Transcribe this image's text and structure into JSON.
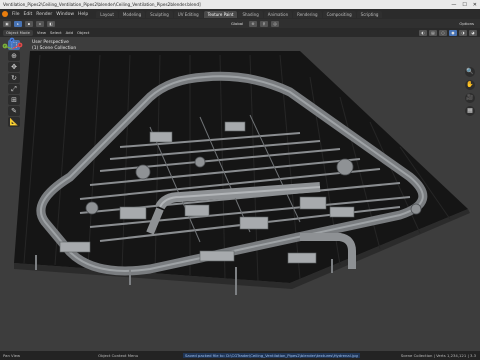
{
  "titlebar": {
    "path": "Ventilation_Pipes2\\Ceiling_Ventilation_Pipes2\\blender\\Ceiling_Ventilation_Pipes2blender.blend]",
    "minimize": "—",
    "maximize": "☐",
    "close": "✕"
  },
  "menubar": {
    "menus": [
      "File",
      "Edit",
      "Render",
      "Window",
      "Help"
    ],
    "tabs": [
      "Layout",
      "Modeling",
      "Sculpting",
      "UV Editing",
      "Texture Paint",
      "Shading",
      "Animation",
      "Rendering",
      "Compositing",
      "Scripting"
    ],
    "active_tab": "Texture Paint",
    "scene": "Scene",
    "view_layer_label": "ViewLayer"
  },
  "header": {
    "orientation": "Global",
    "options": "Options"
  },
  "toolheader": {
    "mode": "Object Mode",
    "menus": [
      "View",
      "Select",
      "Add",
      "Object"
    ]
  },
  "viewport": {
    "view_name": "User Perspective",
    "collection": "(1) Scene Collection"
  },
  "tools": [
    {
      "name": "select-box-tool",
      "glyph": "⬚"
    },
    {
      "name": "cursor-tool",
      "glyph": "⊕"
    },
    {
      "name": "move-tool",
      "glyph": "✥"
    },
    {
      "name": "rotate-tool",
      "glyph": "↻"
    },
    {
      "name": "scale-tool",
      "glyph": "⤢"
    },
    {
      "name": "transform-tool",
      "glyph": "⊞"
    },
    {
      "name": "annotate-tool",
      "glyph": "✎"
    },
    {
      "name": "measure-tool",
      "glyph": "📐"
    }
  ],
  "gizmo": {
    "x": "X",
    "y": "Y",
    "z": "Z"
  },
  "navbuttons": [
    "🔍",
    "✋",
    "🎥",
    "▦"
  ],
  "statusbar": {
    "left": "Pan View",
    "middle": "Object Context Menu",
    "message": "Saved packed file to: D:\\CGTrader\\Ceiling_Ventilation_Pipes2\\blender\\textures\\Hydrenal.jpg",
    "stats": "Scene Collection | Verts 1,234,121 | 3.3"
  },
  "colors": {
    "accent": "#4772b3",
    "blender_orange": "#e87d0d",
    "viewport_bg": "#3d3d3d"
  }
}
